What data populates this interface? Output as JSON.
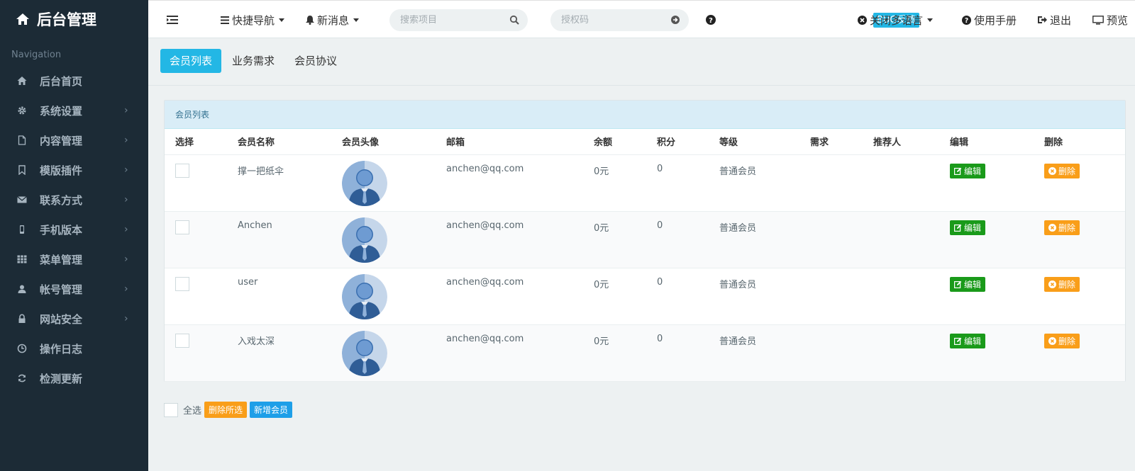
{
  "brand": {
    "title": "后台管理",
    "icon": "home-icon"
  },
  "sidebar": {
    "heading": "Navigation",
    "items": [
      {
        "label": "后台首页",
        "icon": "home-icon",
        "has_submenu": false
      },
      {
        "label": "系统设置",
        "icon": "gear-icon",
        "has_submenu": true
      },
      {
        "label": "内容管理",
        "icon": "file-icon",
        "has_submenu": true
      },
      {
        "label": "模版插件",
        "icon": "bookmark-icon",
        "has_submenu": true
      },
      {
        "label": "联系方式",
        "icon": "envelope-icon",
        "has_submenu": true
      },
      {
        "label": "手机版本",
        "icon": "mobile-icon",
        "has_submenu": true
      },
      {
        "label": "菜单管理",
        "icon": "grid-icon",
        "has_submenu": true
      },
      {
        "label": "帐号管理",
        "icon": "user-icon",
        "has_submenu": true
      },
      {
        "label": "网站安全",
        "icon": "lock-icon",
        "has_submenu": true
      },
      {
        "label": "操作日志",
        "icon": "clock-icon",
        "has_submenu": false
      },
      {
        "label": "检测更新",
        "icon": "refresh-icon",
        "has_submenu": false
      }
    ],
    "chevron": "›"
  },
  "header": {
    "quick_nav": "快捷导航",
    "messages": "新消息",
    "search_placeholder": "搜索项目",
    "auth_placeholder": "授权码",
    "bug_label": "BUG反馈",
    "language": "关闭多语言",
    "manual": "使用手册",
    "logout": "退出",
    "preview": "预览"
  },
  "tabs": [
    {
      "label": "会员列表",
      "active": true
    },
    {
      "label": "业务需求",
      "active": false
    },
    {
      "label": "会员协议",
      "active": false
    }
  ],
  "panel": {
    "title": "会员列表",
    "columns": [
      "选择",
      "会员名称",
      "会员头像",
      "邮箱",
      "余额",
      "积分",
      "等级",
      "需求",
      "推荐人",
      "编辑",
      "删除"
    ],
    "rows": [
      {
        "name": "撑一把纸伞",
        "email": "anchen@qq.com",
        "balance": "0元",
        "points": "0",
        "level": "普通会员",
        "demand": "",
        "referrer": ""
      },
      {
        "name": "Anchen",
        "email": "anchen@qq.com",
        "balance": "0元",
        "points": "0",
        "level": "普通会员",
        "demand": "",
        "referrer": ""
      },
      {
        "name": "user",
        "email": "anchen@qq.com",
        "balance": "0元",
        "points": "0",
        "level": "普通会员",
        "demand": "",
        "referrer": ""
      },
      {
        "name": "入戏太深",
        "email": "anchen@qq.com",
        "balance": "0元",
        "points": "0",
        "level": "普通会员",
        "demand": "",
        "referrer": ""
      }
    ],
    "edit_label": "编辑",
    "delete_label": "删除"
  },
  "footer": {
    "select_all": "全选",
    "delete_selected": "删除所选",
    "add_member": "新增会员"
  },
  "colors": {
    "sidebar_bg": "#1c2b36",
    "accent": "#23b7e5",
    "edit_green": "#1a9a1a",
    "delete_orange": "#f99e19",
    "add_blue": "#1e9fe8"
  }
}
